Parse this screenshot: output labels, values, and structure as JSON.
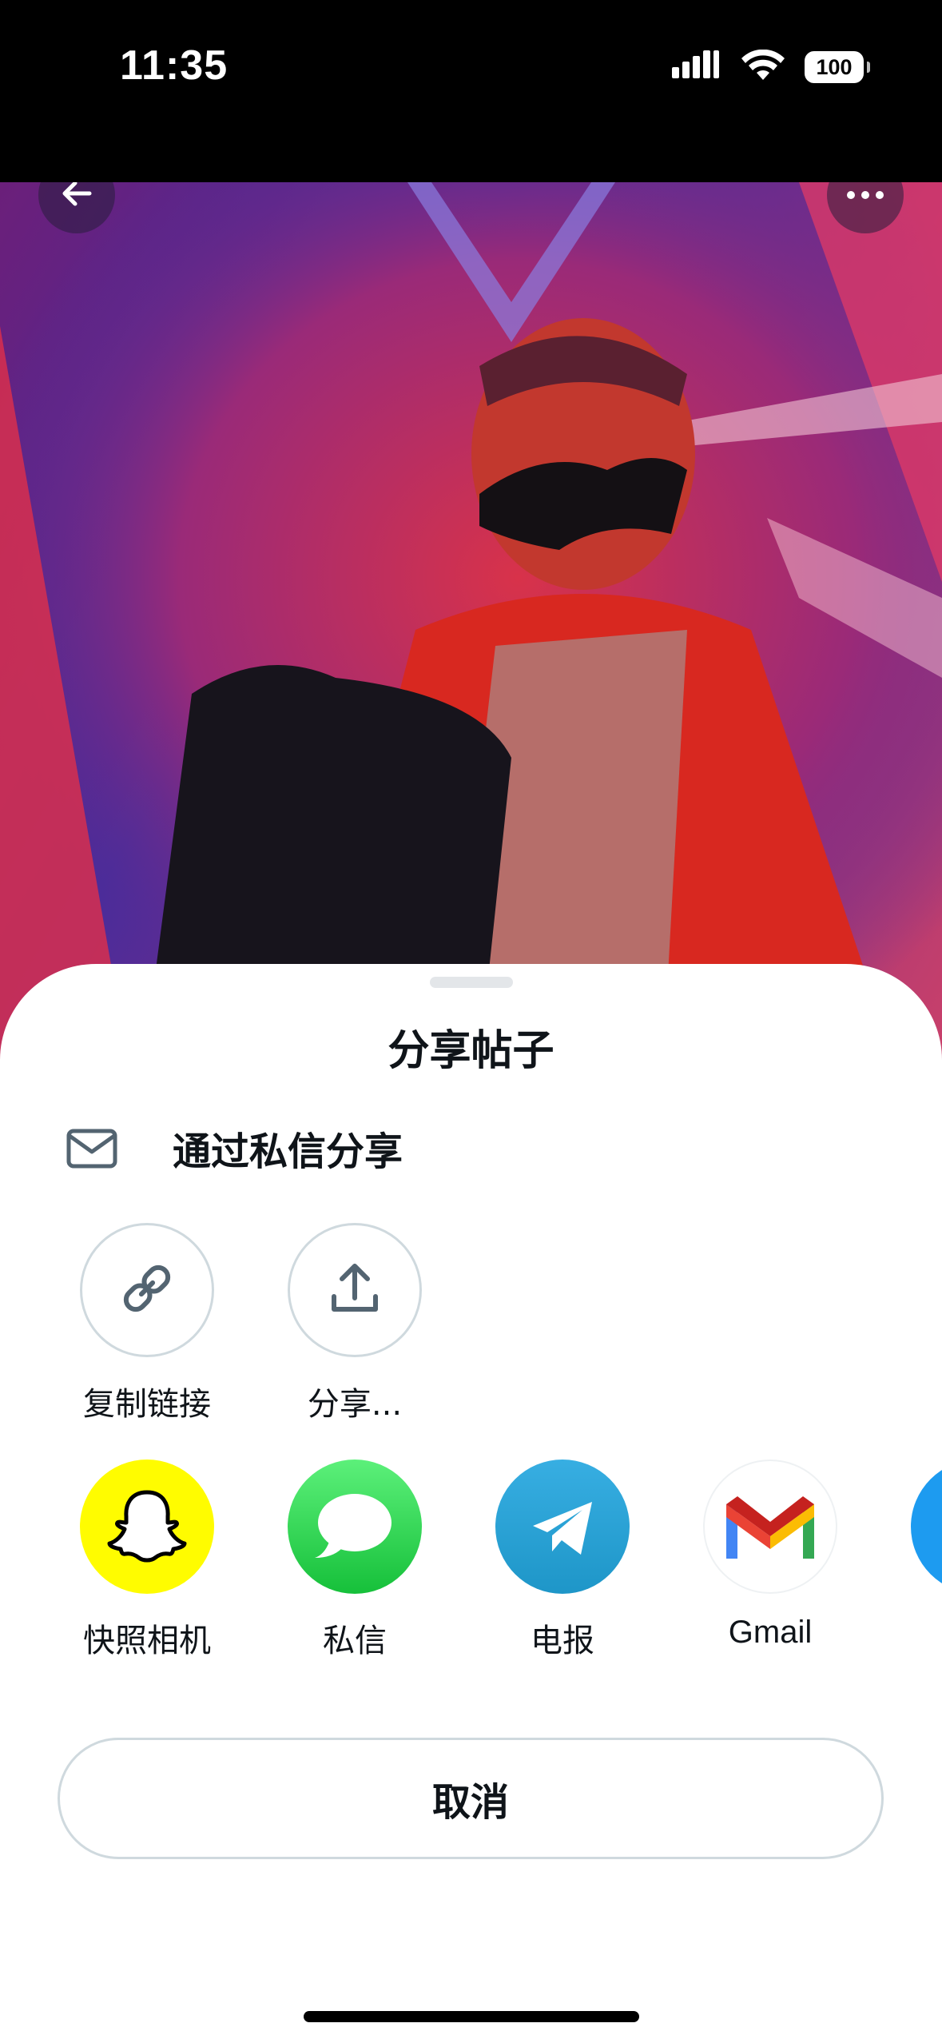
{
  "status_bar": {
    "time": "11:35",
    "battery": "100",
    "icons": [
      "cellular-signal-icon",
      "wifi-icon",
      "battery-icon"
    ]
  },
  "header": {
    "back_icon": "arrow-left-icon",
    "more_icon": "ellipsis-icon"
  },
  "sheet": {
    "title": "分享帖子",
    "dm_share": {
      "label": "通过私信分享",
      "icon": "envelope-icon"
    },
    "actions": [
      {
        "label": "复制链接",
        "icon": "link-icon"
      },
      {
        "label": "分享...",
        "icon": "share-upload-icon"
      }
    ],
    "apps": [
      {
        "label": "快照相机",
        "icon": "snapchat-icon",
        "color": "#FFFC00"
      },
      {
        "label": "私信",
        "icon": "messages-icon",
        "color": "#34C759"
      },
      {
        "label": "电报",
        "icon": "telegram-icon",
        "color": "#2AA3E0"
      },
      {
        "label": "Gmail",
        "icon": "gmail-icon",
        "color": "#FFFFFF"
      },
      {
        "icon": "more-app-icon",
        "color": "#1D9BF0"
      }
    ],
    "cancel_label": "取消"
  },
  "colors": {
    "text_primary": "#0F1419",
    "border": "#CFD9DE",
    "icon_gray": "#536471"
  }
}
